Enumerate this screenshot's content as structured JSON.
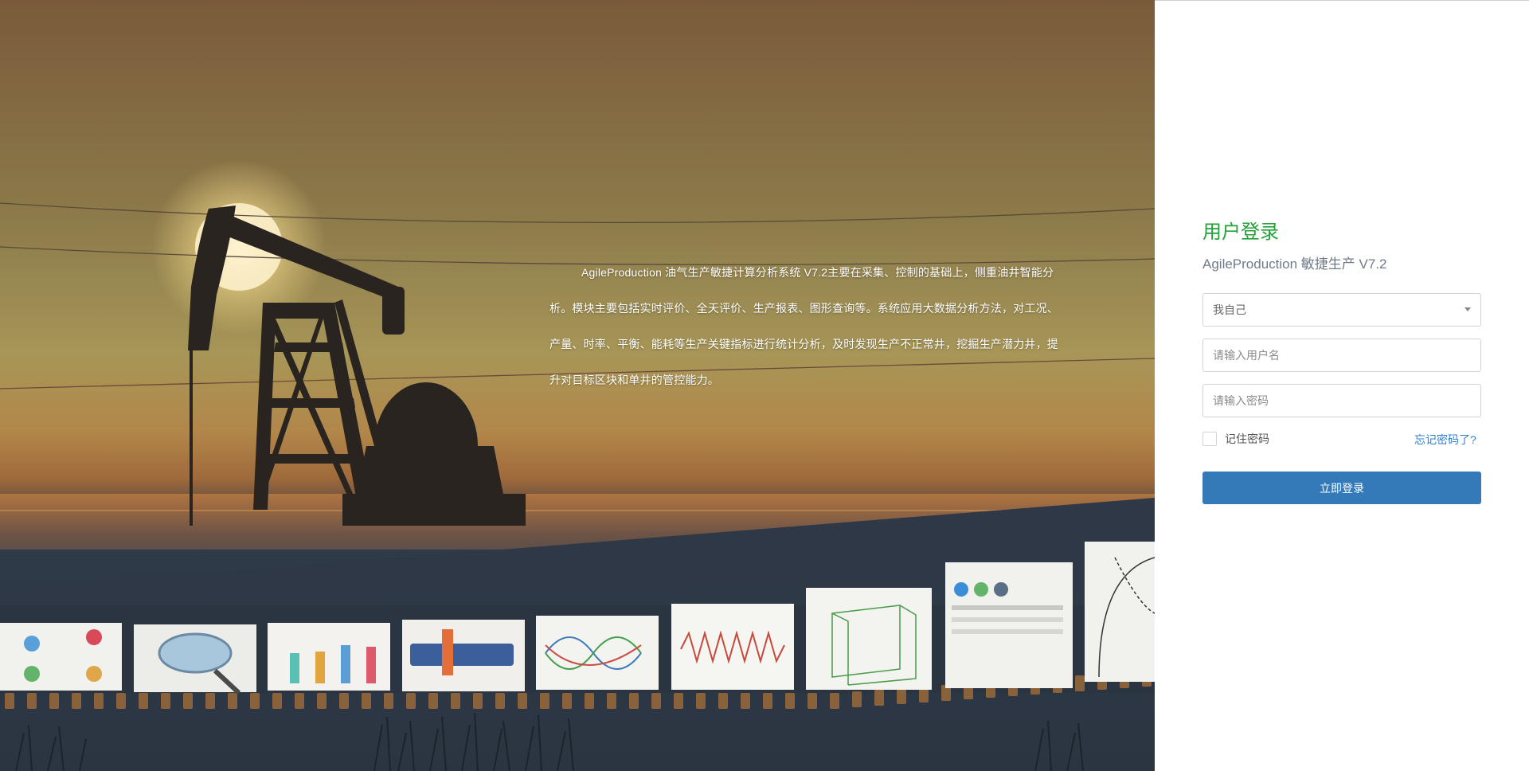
{
  "hero": {
    "description": "AgileProduction 油气生产敏捷计算分析系统 V7.2主要在采集、控制的基础上，侧重油井智能分析。模块主要包括实时评价、全天评价、生产报表、图形查询等。系统应用大数据分析方法，对工况、产量、时率、平衡、能耗等生产关键指标进行统计分析，及时发现生产不正常井，挖掘生产潜力井，提升对目标区块和单井的管控能力。"
  },
  "login": {
    "title": "用户登录",
    "subtitle": "AgileProduction 敏捷生产 V7.2",
    "org_select_value": "我自己",
    "username_placeholder": "请输入用户名",
    "password_placeholder": "请输入密码",
    "remember_label": "记住密码",
    "forgot_label": "忘记密码了?",
    "submit_label": "立即登录"
  },
  "colors": {
    "title_green": "#23a23a",
    "button_blue": "#3479b8",
    "link_blue": "#2f7fd1"
  }
}
